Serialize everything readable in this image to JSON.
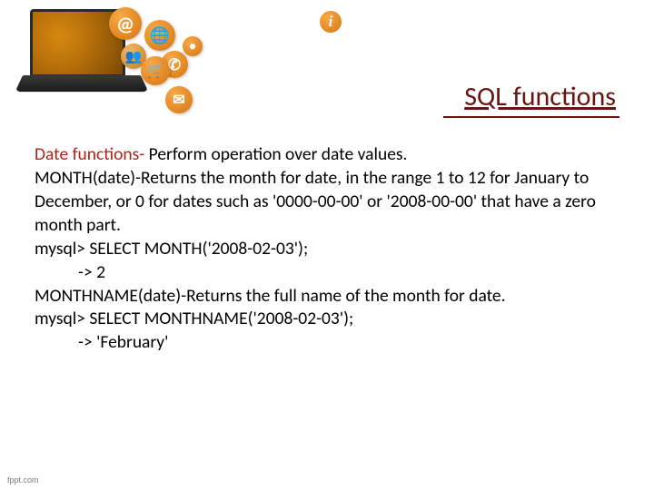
{
  "header": {
    "info_icon_label": "i"
  },
  "title": "SQL functions",
  "body": {
    "line1_a": "Date functions-",
    "line1_b": " Perform operation over date values.",
    "line2": "MONTH(date)-Returns the month for date, in the range 1 to 12 for January to December, or 0 for dates such as '0000-00-00' or '2008-00-00' that have a zero month part.",
    "line3": "mysql> SELECT MONTH('2008-02-03');",
    "line4": "-> 2",
    "line5": "MONTHNAME(date)-Returns the full name of the month for  date.",
    "line6": "mysql> SELECT MONTHNAME('2008-02-03');",
    "line7": "-> 'February'"
  },
  "footer": "fppt.com",
  "icons": {
    "at": "@",
    "globe": "🌐",
    "people": "👥",
    "phone": "✆",
    "cart": "🛒",
    "mail": "✉",
    "dot": "●"
  }
}
